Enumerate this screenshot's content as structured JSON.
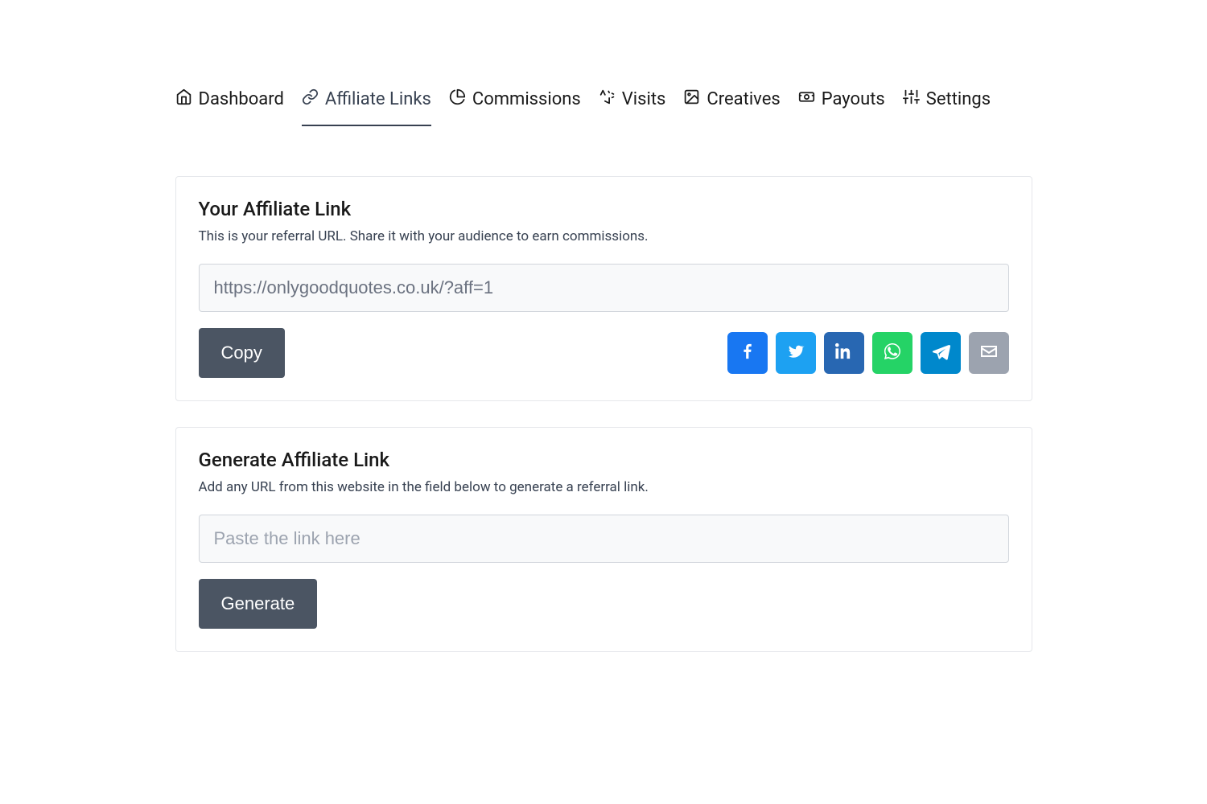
{
  "tabs": {
    "dashboard": "Dashboard",
    "affiliate_links": "Affiliate Links",
    "commissions": "Commissions",
    "visits": "Visits",
    "creatives": "Creatives",
    "payouts": "Payouts",
    "settings": "Settings"
  },
  "affiliate_link_section": {
    "heading": "Your Affiliate Link",
    "description": "This is your referral URL. Share it with your audience to earn commissions.",
    "url": "https://onlygoodquotes.co.uk/?aff=1",
    "copy_button": "Copy"
  },
  "generate_section": {
    "heading": "Generate Affiliate Link",
    "description": "Add any URL from this website in the field below to generate a referral link.",
    "placeholder": "Paste the link here",
    "generate_button": "Generate"
  },
  "share": {
    "facebook": "facebook",
    "twitter": "twitter",
    "linkedin": "linkedin",
    "whatsapp": "whatsapp",
    "telegram": "telegram",
    "email": "email"
  }
}
